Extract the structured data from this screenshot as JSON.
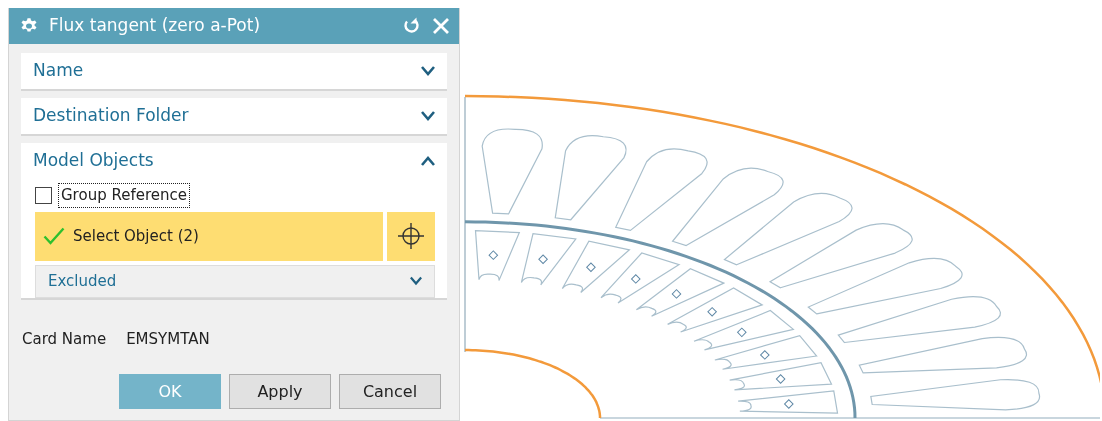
{
  "window": {
    "title": "Flux tangent (zero a-Pot)"
  },
  "sections": [
    {
      "label": "Name",
      "expanded": false
    },
    {
      "label": "Destination Folder",
      "expanded": false
    },
    {
      "label": "Model Objects",
      "expanded": true
    }
  ],
  "group_reference": {
    "label": "Group Reference",
    "checked": false
  },
  "select_object": {
    "label": "Select Object (2)",
    "completed": true
  },
  "excluded": {
    "label": "Excluded",
    "expanded": false
  },
  "card_name": {
    "label": "Card Name",
    "value": "EMSYMTAN"
  },
  "buttons": [
    {
      "label": "OK",
      "kind": "primary"
    },
    {
      "label": "Apply",
      "kind": "default"
    },
    {
      "label": "Cancel",
      "kind": "default"
    }
  ]
}
